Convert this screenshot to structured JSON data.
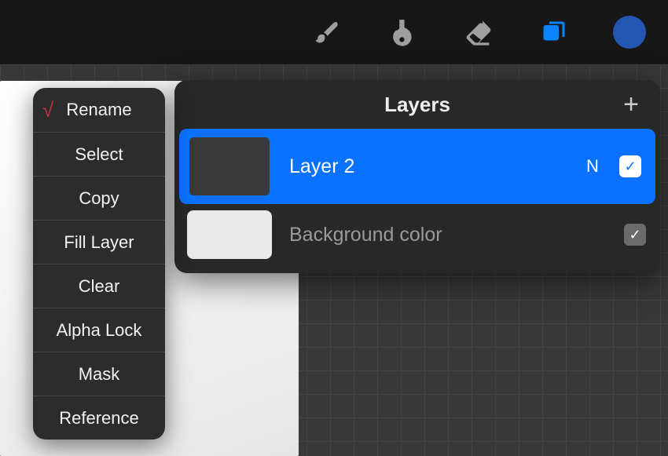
{
  "toolbar": {
    "tools": [
      {
        "name": "brush-icon",
        "active": false
      },
      {
        "name": "smudge-icon",
        "active": false
      },
      {
        "name": "eraser-icon",
        "active": false
      },
      {
        "name": "layers-icon",
        "active": true
      }
    ],
    "color_swatch": "#2457b3"
  },
  "context_menu": {
    "highlighted": "Rename",
    "pointer_from": "Select",
    "items": [
      "Rename",
      "Select",
      "Copy",
      "Fill Layer",
      "Clear",
      "Alpha Lock",
      "Mask",
      "Reference"
    ]
  },
  "layers_panel": {
    "title": "Layers",
    "add_label": "+",
    "layers": [
      {
        "name": "Layer 2",
        "blend_mode_letter": "N",
        "visible": true,
        "selected": true,
        "thumb": "dark"
      }
    ],
    "background": {
      "label": "Background color",
      "visible": true,
      "thumb": "light"
    }
  },
  "glyphs": {
    "check": "✓"
  }
}
